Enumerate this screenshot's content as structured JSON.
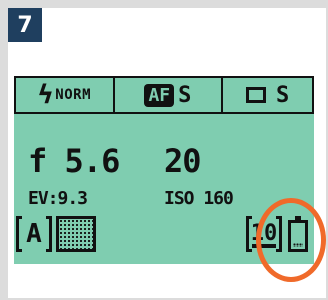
{
  "step": {
    "number": "7"
  },
  "lcd": {
    "flash": {
      "icon": "flash-icon",
      "mode": "NORM"
    },
    "af": {
      "badge": "AF",
      "mode": "S"
    },
    "drive": {
      "icon": "single-frame-icon",
      "mode": "S"
    },
    "aperture": "f 5.6",
    "shutter": "20",
    "ev": "EV:9.3",
    "iso": "ISO 160",
    "exposure_mode": "A",
    "metering": {
      "icon": "matrix-metering-icon"
    },
    "self_timer": {
      "icon": "self-timer-icon",
      "value": "10"
    },
    "battery": {
      "icon": "battery-low-icon",
      "level_fraction": 0.15
    }
  },
  "colors": {
    "lcd_background": "#7fcdb0",
    "badge_background": "#1f3f5f",
    "highlight": "#f06a2a"
  }
}
